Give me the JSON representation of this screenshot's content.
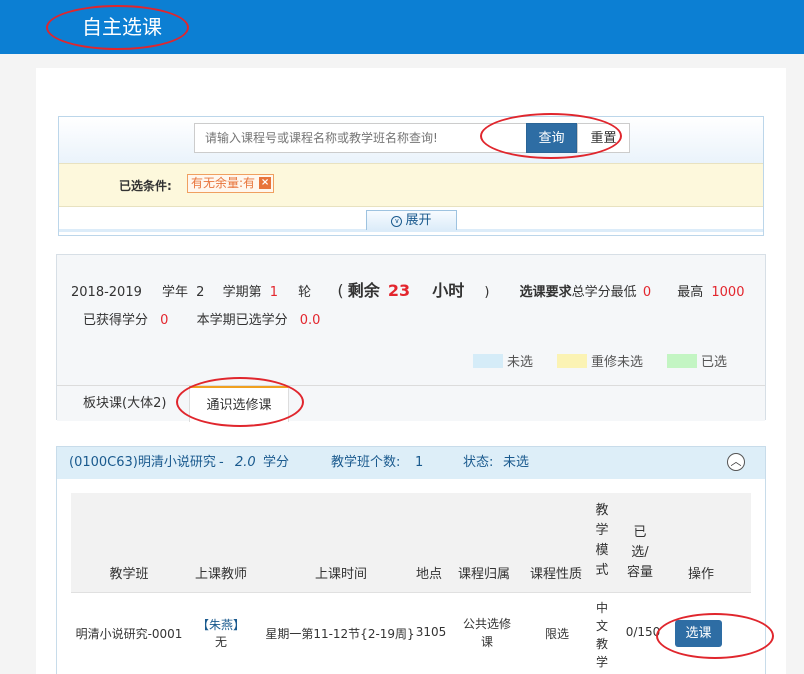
{
  "header": {
    "title": "自主选课"
  },
  "search": {
    "placeholder": "请输入课程号或课程名称或教学班名称查询!",
    "query_label": "查询",
    "reset_label": "重置",
    "selected_label": "已选条件:",
    "selected_tag": "有无余量:有",
    "tag_remove": "×",
    "expand_label": "展开"
  },
  "info": {
    "year": "2018-2019",
    "xuenian_label": "学年",
    "xuenian_value": "2",
    "term_label": "学期第",
    "term_value": "1",
    "round_label": "轮",
    "open_paren": "(",
    "remaining_label": "剩余",
    "remaining_value": "23",
    "hours_label": "小时",
    "close_paren": ")",
    "requirement_label": "选课要求",
    "min_label": "总学分最低",
    "min_value": "0",
    "max_label": "最高",
    "max_value": "1000",
    "earned_label": "已获得学分",
    "earned_value": "0",
    "term_selected_label": "本学期已选学分",
    "term_selected_value": "0.0",
    "legend": [
      {
        "label": "未选",
        "color": "#d5ecf8"
      },
      {
        "label": "重修未选",
        "color": "#fbf3b4"
      },
      {
        "label": "已选",
        "color": "#c3f5c3"
      }
    ]
  },
  "tabs": [
    {
      "label": "板块课(大体2)"
    },
    {
      "label": "通识选修课"
    }
  ],
  "course": {
    "code_name": "(0100C63)明清小说研究",
    "dash": "-",
    "credit": "2.0",
    "credit_unit": "学分",
    "class_count_label": "教学班个数:",
    "class_count": "1",
    "status_label": "状态:",
    "status": "未选",
    "toggle_icon": "︿"
  },
  "table": {
    "headers": {
      "class": "教学班",
      "teacher": "上课教师",
      "time": "上课时间",
      "place": "地点",
      "belong": "课程归属",
      "nature": "课程性质",
      "mode": "教学模式",
      "capacity": "已选/容量",
      "action": "操作"
    },
    "rows": [
      {
        "class": "明清小说研究-0001",
        "teacher_name": "【朱燕】",
        "teacher_title": "无",
        "time": "星期一第11-12节{2-19周}",
        "place": "3105",
        "belong": "公共选修课",
        "nature": "限选",
        "mode": "中文教学",
        "capacity": "0/150",
        "action": "选课"
      }
    ]
  },
  "colors": {
    "topbar": "#0c7fd3",
    "primary_button": "#2e6da4",
    "highlight_red": "#e3262e",
    "annotation_red": "#e0262d"
  }
}
